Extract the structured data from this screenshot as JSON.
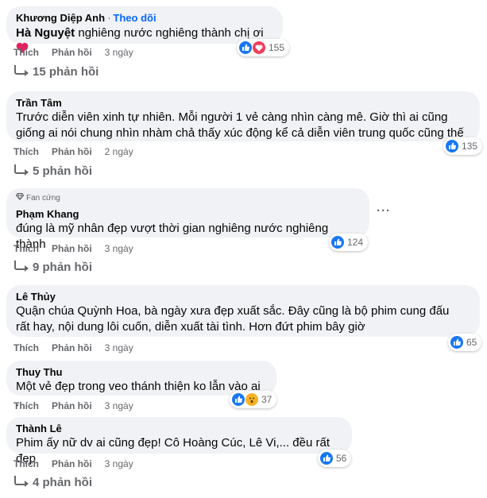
{
  "actions": {
    "like": "Thích",
    "reply": "Phản hồi"
  },
  "comments": [
    {
      "author": "Khương Diệp Anh",
      "follow": "Theo dõi",
      "mention": "Hà Nguyệt",
      "text": " nghiêng nước nghiêng thành chị ơi",
      "time": "3 ngày",
      "reactions": "155",
      "replies": "15 phản hồi"
    },
    {
      "author": "Trần Tâm",
      "text": "Trước diễn viên xinh tự nhiên. Mỗi người 1 vẻ càng nhìn càng mê. Giờ thì ai cũng giống ai nói chung nhìn nhàm chả thấy xúc động kể cả diễn viên trung quốc cũng thế",
      "time": "2 ngày",
      "reactions": "135",
      "replies": "5 phản hồi"
    },
    {
      "badge": "Fan cứng",
      "author": "Phạm Khang",
      "text": "đúng là mỹ nhân đẹp vượt thời gian nghiêng nước nghiêng thành",
      "time": "3 ngày",
      "reactions": "124",
      "replies": "9 phản hồi"
    },
    {
      "author": "Lê Thủy",
      "text": "Quận chúa Quỳnh Hoa, bà ngày xưa đẹp xuất sắc. Đây cũng là bộ phim cung đấu rất hay, nội dung lôi cuốn, diễn xuất tài tình. Hơn đứt phim bây giờ",
      "time": "3 ngày",
      "reactions": "65"
    },
    {
      "author": "Thuy Thu",
      "text": "Một vẻ đẹp trong veo thánh thiện ko lẫn vào ai .",
      "time": "3 ngày",
      "reactions": "37"
    },
    {
      "author": "Thành Lê",
      "text": "Phim ấy nữ dv ai cũng đẹp! Cô Hoàng Cúc, Lê Vi,... đều rất đẹp",
      "time": "3 ngày",
      "reactions": "56",
      "replies": "4 phản hồi"
    }
  ]
}
